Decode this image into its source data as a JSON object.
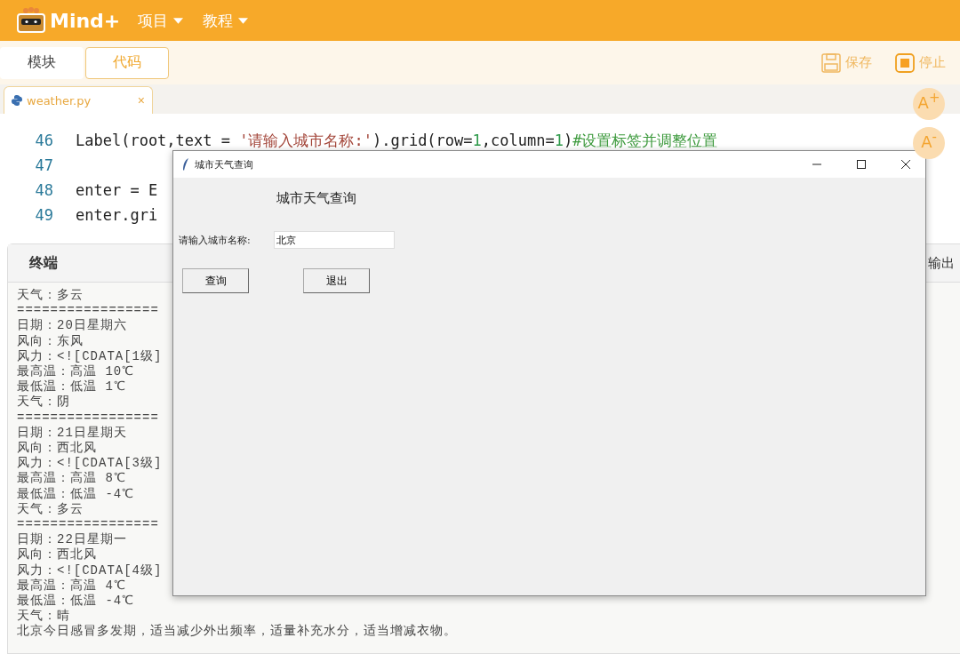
{
  "app": {
    "logo": "Mind+",
    "menus": [
      {
        "label": "项目"
      },
      {
        "label": "教程"
      }
    ]
  },
  "mode_tabs": [
    {
      "label": "模块",
      "selected": false
    },
    {
      "label": "代码",
      "selected": true
    }
  ],
  "actions": [
    {
      "kind": "save",
      "label": "保存"
    },
    {
      "kind": "stop",
      "label": "停止"
    }
  ],
  "file_tab": {
    "name": "weather.py",
    "close": "×"
  },
  "font_buttons": [
    "A$^{+}$",
    "A$^{-}$"
  ],
  "code_lines": [
    {
      "number": "46",
      "tokens": [
        {
          "kind": "plain",
          "text": "Label(root,text = "
        },
        {
          "kind": "string",
          "text": "'请输入城市名称:'"
        },
        {
          "kind": "plain",
          "text": ").grid(row="
        },
        {
          "kind": "number",
          "text": "1"
        },
        {
          "kind": "plain",
          "text": ",column="
        },
        {
          "kind": "number",
          "text": "1"
        },
        {
          "kind": "plain",
          "text": ")"
        },
        {
          "kind": "comment",
          "text": "#设置标签并调整位置"
        }
      ]
    },
    {
      "number": "47"
    },
    {
      "number": "48",
      "tokens": [
        {
          "kind": "plain",
          "text": "enter = E"
        }
      ]
    },
    {
      "number": "49",
      "tokens": [
        {
          "kind": "plain",
          "text": "enter.gri"
        }
      ]
    }
  ],
  "terminal": {
    "tabs": [
      {
        "label": "终端",
        "selected": true
      },
      {
        "label": "输出",
        "selected": false
      }
    ],
    "lines": [
      "天气：多云",
      "=================",
      "日期：20日星期六",
      "风向：东风",
      "风力：<![CDATA[1级]",
      "最高温：高温 10℃",
      "最低温：低温 1℃",
      "天气：阴",
      "=================",
      "日期：21日星期天",
      "风向：西北风",
      "风力：<![CDATA[3级]",
      "最高温：高温 8℃",
      "最低温：低温 -4℃",
      "天气：多云",
      "=================",
      "日期：22日星期一",
      "风向：西北风",
      "风力：<![CDATA[4级]",
      "最高温：高温 4℃",
      "最低温：低温 -4℃",
      "天气：晴",
      "北京今日感冒多发期，适当减少外出频率，适量补充水分，适当增减衣物。"
    ]
  },
  "dialog": {
    "title": "城市天气查询",
    "heading": "城市天气查询",
    "field_label": "请输入城市名称:",
    "field_value": "北京",
    "buttons": [
      "查询",
      "退出"
    ]
  }
}
